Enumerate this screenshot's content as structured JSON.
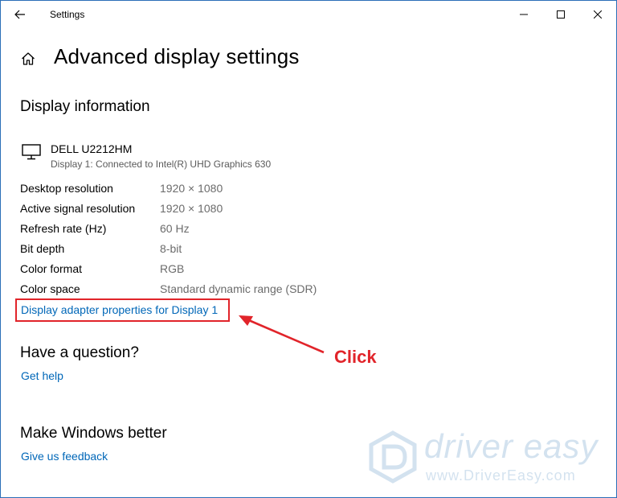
{
  "window": {
    "app_title": "Settings"
  },
  "page": {
    "title": "Advanced display settings"
  },
  "display_info": {
    "heading": "Display information",
    "monitor_name": "DELL U2212HM",
    "monitor_description": "Display 1: Connected to Intel(R) UHD Graphics 630",
    "rows": [
      {
        "label": "Desktop resolution",
        "value": "1920 × 1080"
      },
      {
        "label": "Active signal resolution",
        "value": "1920 × 1080"
      },
      {
        "label": "Refresh rate (Hz)",
        "value": "60 Hz"
      },
      {
        "label": "Bit depth",
        "value": "8-bit"
      },
      {
        "label": "Color format",
        "value": "RGB"
      },
      {
        "label": "Color space",
        "value": "Standard dynamic range (SDR)"
      }
    ],
    "adapter_link": "Display adapter properties for Display 1"
  },
  "question": {
    "heading": "Have a question?",
    "link": "Get help"
  },
  "feedback": {
    "heading": "Make Windows better",
    "link": "Give us feedback"
  },
  "annotation": {
    "click_label": "Click",
    "color": "#e1242a"
  },
  "watermark": {
    "brand": "driver easy",
    "url": "www.DriverEasy.com"
  },
  "icons": {
    "back": "back-arrow-icon",
    "home": "home-icon",
    "minimize": "minimize-icon",
    "maximize": "maximize-icon",
    "close": "close-icon",
    "monitor": "monitor-icon"
  },
  "colors": {
    "link": "#0067b8",
    "frame_border": "#2b6fb8",
    "secondary_text": "#6b6b6b"
  }
}
